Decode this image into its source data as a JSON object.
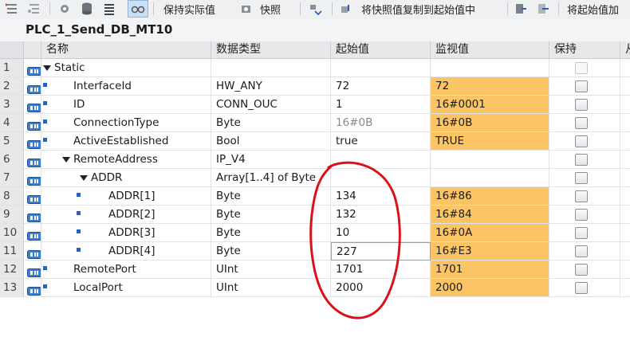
{
  "toolbar": {
    "keep_actual": "保持实际值",
    "snapshot": "快照",
    "copy_snapshot_to_start": "将快照值复制到起始值中",
    "load_start_as": "将起始值加"
  },
  "block": {
    "title": "PLC_1_Send_DB_MT10"
  },
  "columns": [
    "名称",
    "数据类型",
    "起始值",
    "监视值",
    "保持",
    "从"
  ],
  "rows": [
    {
      "num": "1",
      "name": "Static",
      "type": "",
      "start": "",
      "monitor": "",
      "level": 0,
      "expander": "open"
    },
    {
      "num": "2",
      "name": "InterfaceId",
      "type": "HW_ANY",
      "start": "72",
      "monitor": "72",
      "level": 1
    },
    {
      "num": "3",
      "name": "ID",
      "type": "CONN_OUC",
      "start": "1",
      "monitor": "16#0001",
      "level": 1
    },
    {
      "num": "4",
      "name": "ConnectionType",
      "type": "Byte",
      "start": "16#0B",
      "monitor": "16#0B",
      "level": 1,
      "start_gray": true
    },
    {
      "num": "5",
      "name": "ActiveEstablished",
      "type": "Bool",
      "start": "true",
      "monitor": "TRUE",
      "level": 1
    },
    {
      "num": "6",
      "name": "RemoteAddress",
      "type": "IP_V4",
      "start": "",
      "monitor": "",
      "level": 1,
      "expander": "open"
    },
    {
      "num": "7",
      "name": "ADDR",
      "type": "Array[1..4] of Byte",
      "start": "",
      "monitor": "",
      "level": 2,
      "expander": "open"
    },
    {
      "num": "8",
      "name": "ADDR[1]",
      "type": "Byte",
      "start": "134",
      "monitor": "16#86",
      "level": 3
    },
    {
      "num": "9",
      "name": "ADDR[2]",
      "type": "Byte",
      "start": "132",
      "monitor": "16#84",
      "level": 3
    },
    {
      "num": "10",
      "name": "ADDR[3]",
      "type": "Byte",
      "start": "10",
      "monitor": "16#0A",
      "level": 3
    },
    {
      "num": "11",
      "name": "ADDR[4]",
      "type": "Byte",
      "start": "227",
      "monitor": "16#E3",
      "level": 3,
      "editing": true
    },
    {
      "num": "12",
      "name": "RemotePort",
      "type": "UInt",
      "start": "1701",
      "monitor": "1701",
      "level": 1
    },
    {
      "num": "13",
      "name": "LocalPort",
      "type": "UInt",
      "start": "2000",
      "monitor": "2000",
      "level": 1
    }
  ],
  "colors": {
    "monitor_bg": "#fbc465",
    "annotation": "#d9121a",
    "dot": "#2a62b8"
  }
}
